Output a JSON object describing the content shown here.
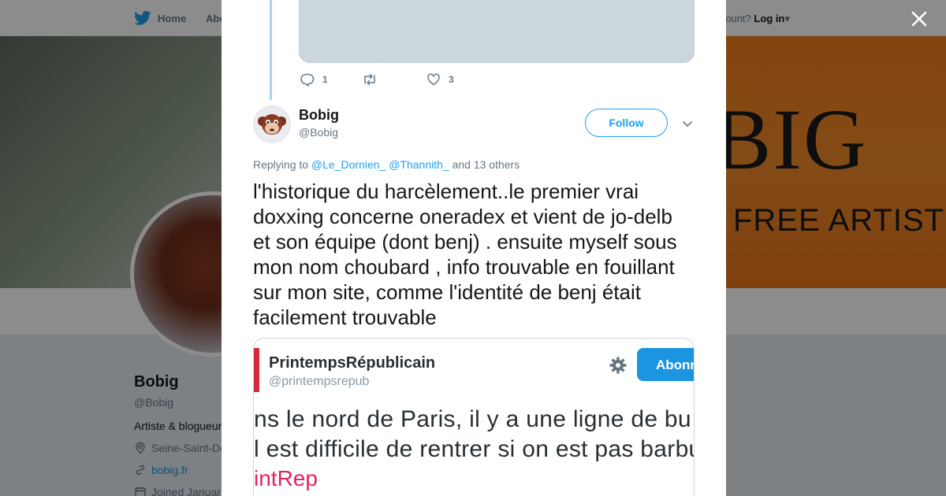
{
  "topbar": {
    "home_label": "Home",
    "about_label": "Abo",
    "account_prompt": "account?",
    "login_label": "Log in"
  },
  "banner": {
    "big_word": "BIG",
    "free_word": "FREE ARTIST"
  },
  "profile": {
    "name": "Bobig",
    "handle": "@Bobig",
    "bio": "Artiste & blogueur",
    "location": "Seine-Saint-De",
    "website": "bobig.fr",
    "joined": "Joined Januar"
  },
  "previous_tweet": {
    "reply_count": "1",
    "retweet_count": "",
    "like_count": "3"
  },
  "tweet": {
    "author_name": "Bobig",
    "author_handle": "@Bobig",
    "follow_label": "Follow",
    "replying_prefix": "Replying to",
    "mention_1": "@Le_Dornien_",
    "mention_2": "@Thannith_",
    "replying_suffix": "and 13 others",
    "text": "l'historique du harcèlement..le premier vrai doxxing concerne oneradex et vient de jo-delb et son équipe (dont benj) . ensuite myself sous mon nom choubard , info trouvable en fouillant sur mon site, comme l'identité de benj était facilement trouvable"
  },
  "embedded_image": {
    "account_name": "PrintempsRépublicain",
    "account_handle": "@printempsrepub",
    "follow_label": "Abonn",
    "line_1": "ns le nord de Paris, il y a une ligne de bu",
    "line_2": "l est difficile de rentrer si on est pas barbu",
    "hashtag": "intRep"
  },
  "colors": {
    "twitter_blue": "#1da1f2",
    "thread_line": "#a6d4f2",
    "secondary_text": "#657786",
    "banner_orange": "#f07d1c"
  }
}
